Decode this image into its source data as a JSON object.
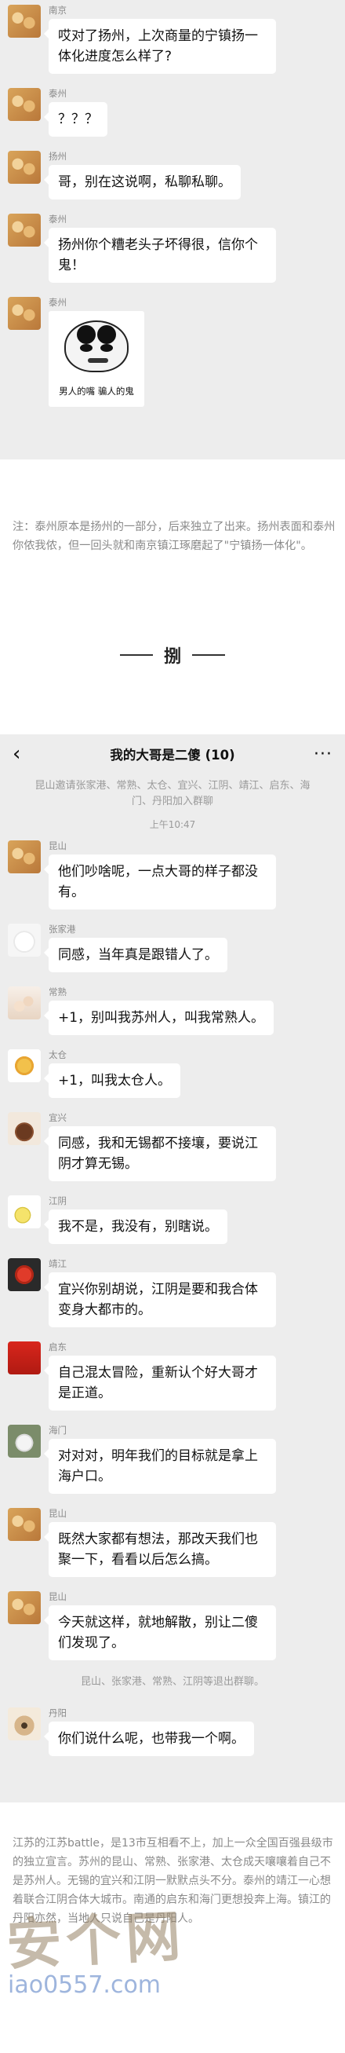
{
  "chat1": {
    "messages": [
      {
        "sender": "南京",
        "text": "哎对了扬州，上次商量的宁镇扬一体化进度怎么样了?"
      },
      {
        "sender": "泰州",
        "text": "？？？"
      },
      {
        "sender": "扬州",
        "text": "哥，别在这说啊，私聊私聊。"
      },
      {
        "sender": "泰州",
        "text": "扬州你个糟老头子坏得很，信你个鬼！"
      },
      {
        "sender": "泰州",
        "sticker_caption": "男人的嘴  骗人的鬼"
      }
    ]
  },
  "note": {
    "text": "注：泰州原本是扬州的一部分，后来独立了出来。扬州表面和泰州你侬我侬，但一回头就和南京镇江琢磨起了\"宁镇扬一体化\"。",
    "divider_char": "捌"
  },
  "chat2": {
    "header": {
      "back": "‹",
      "title": "我的大哥是二傻 (10)",
      "more": "···"
    },
    "join_notice": "昆山邀请张家港、常熟、太仓、宜兴、江阴、靖江、启东、海门、丹阳加入群聊",
    "time": "上午10:47",
    "messages": [
      {
        "sender": "昆山",
        "text": "他们吵啥呢，一点大哥的样子都没有。"
      },
      {
        "sender": "张家港",
        "text": "同感，当年真是跟错人了。"
      },
      {
        "sender": "常熟",
        "text": "+1，别叫我苏州人，叫我常熟人。"
      },
      {
        "sender": "太仓",
        "text": "+1，叫我太仓人。"
      },
      {
        "sender": "宜兴",
        "text": "同感，我和无锡都不接壤，要说江阴才算无锡。"
      },
      {
        "sender": "江阴",
        "text": "我不是，我没有，别瞎说。"
      },
      {
        "sender": "靖江",
        "text": "宜兴你别胡说，江阴是要和我合体变身大都市的。"
      },
      {
        "sender": "启东",
        "text": "自己混太冒险，重新认个好大哥才是正道。"
      },
      {
        "sender": "海门",
        "text": "对对对，明年我们的目标就是拿上海户口。"
      },
      {
        "sender": "昆山",
        "text": "既然大家都有想法，那改天我们也聚一下，看看以后怎么搞。"
      },
      {
        "sender": "昆山",
        "text": "今天就这样，就地解散，别让二傻们发现了。"
      }
    ],
    "leave_notice": "昆山、张家港、常熟、江阴等退出群聊。",
    "last_message": {
      "sender": "丹阳",
      "text": "你们说什么呢，也带我一个啊。"
    }
  },
  "bottom": {
    "text": "江苏的江苏battle，是13市互相看不上，加上一众全国百强县级市的独立宣言。苏州的昆山、常熟、张家港、太仓成天嚷嚷着自己不是苏州人。无锡的宜兴和江阴一默默点头不分。泰州的靖江一心想着联合江阴合体大城市。南通的启东和海门更想投奔上海。镇江的丹阳亦然，当地人只说自己是丹阳人。",
    "watermark": "安个网",
    "watermark_url": "iao0557.com"
  }
}
